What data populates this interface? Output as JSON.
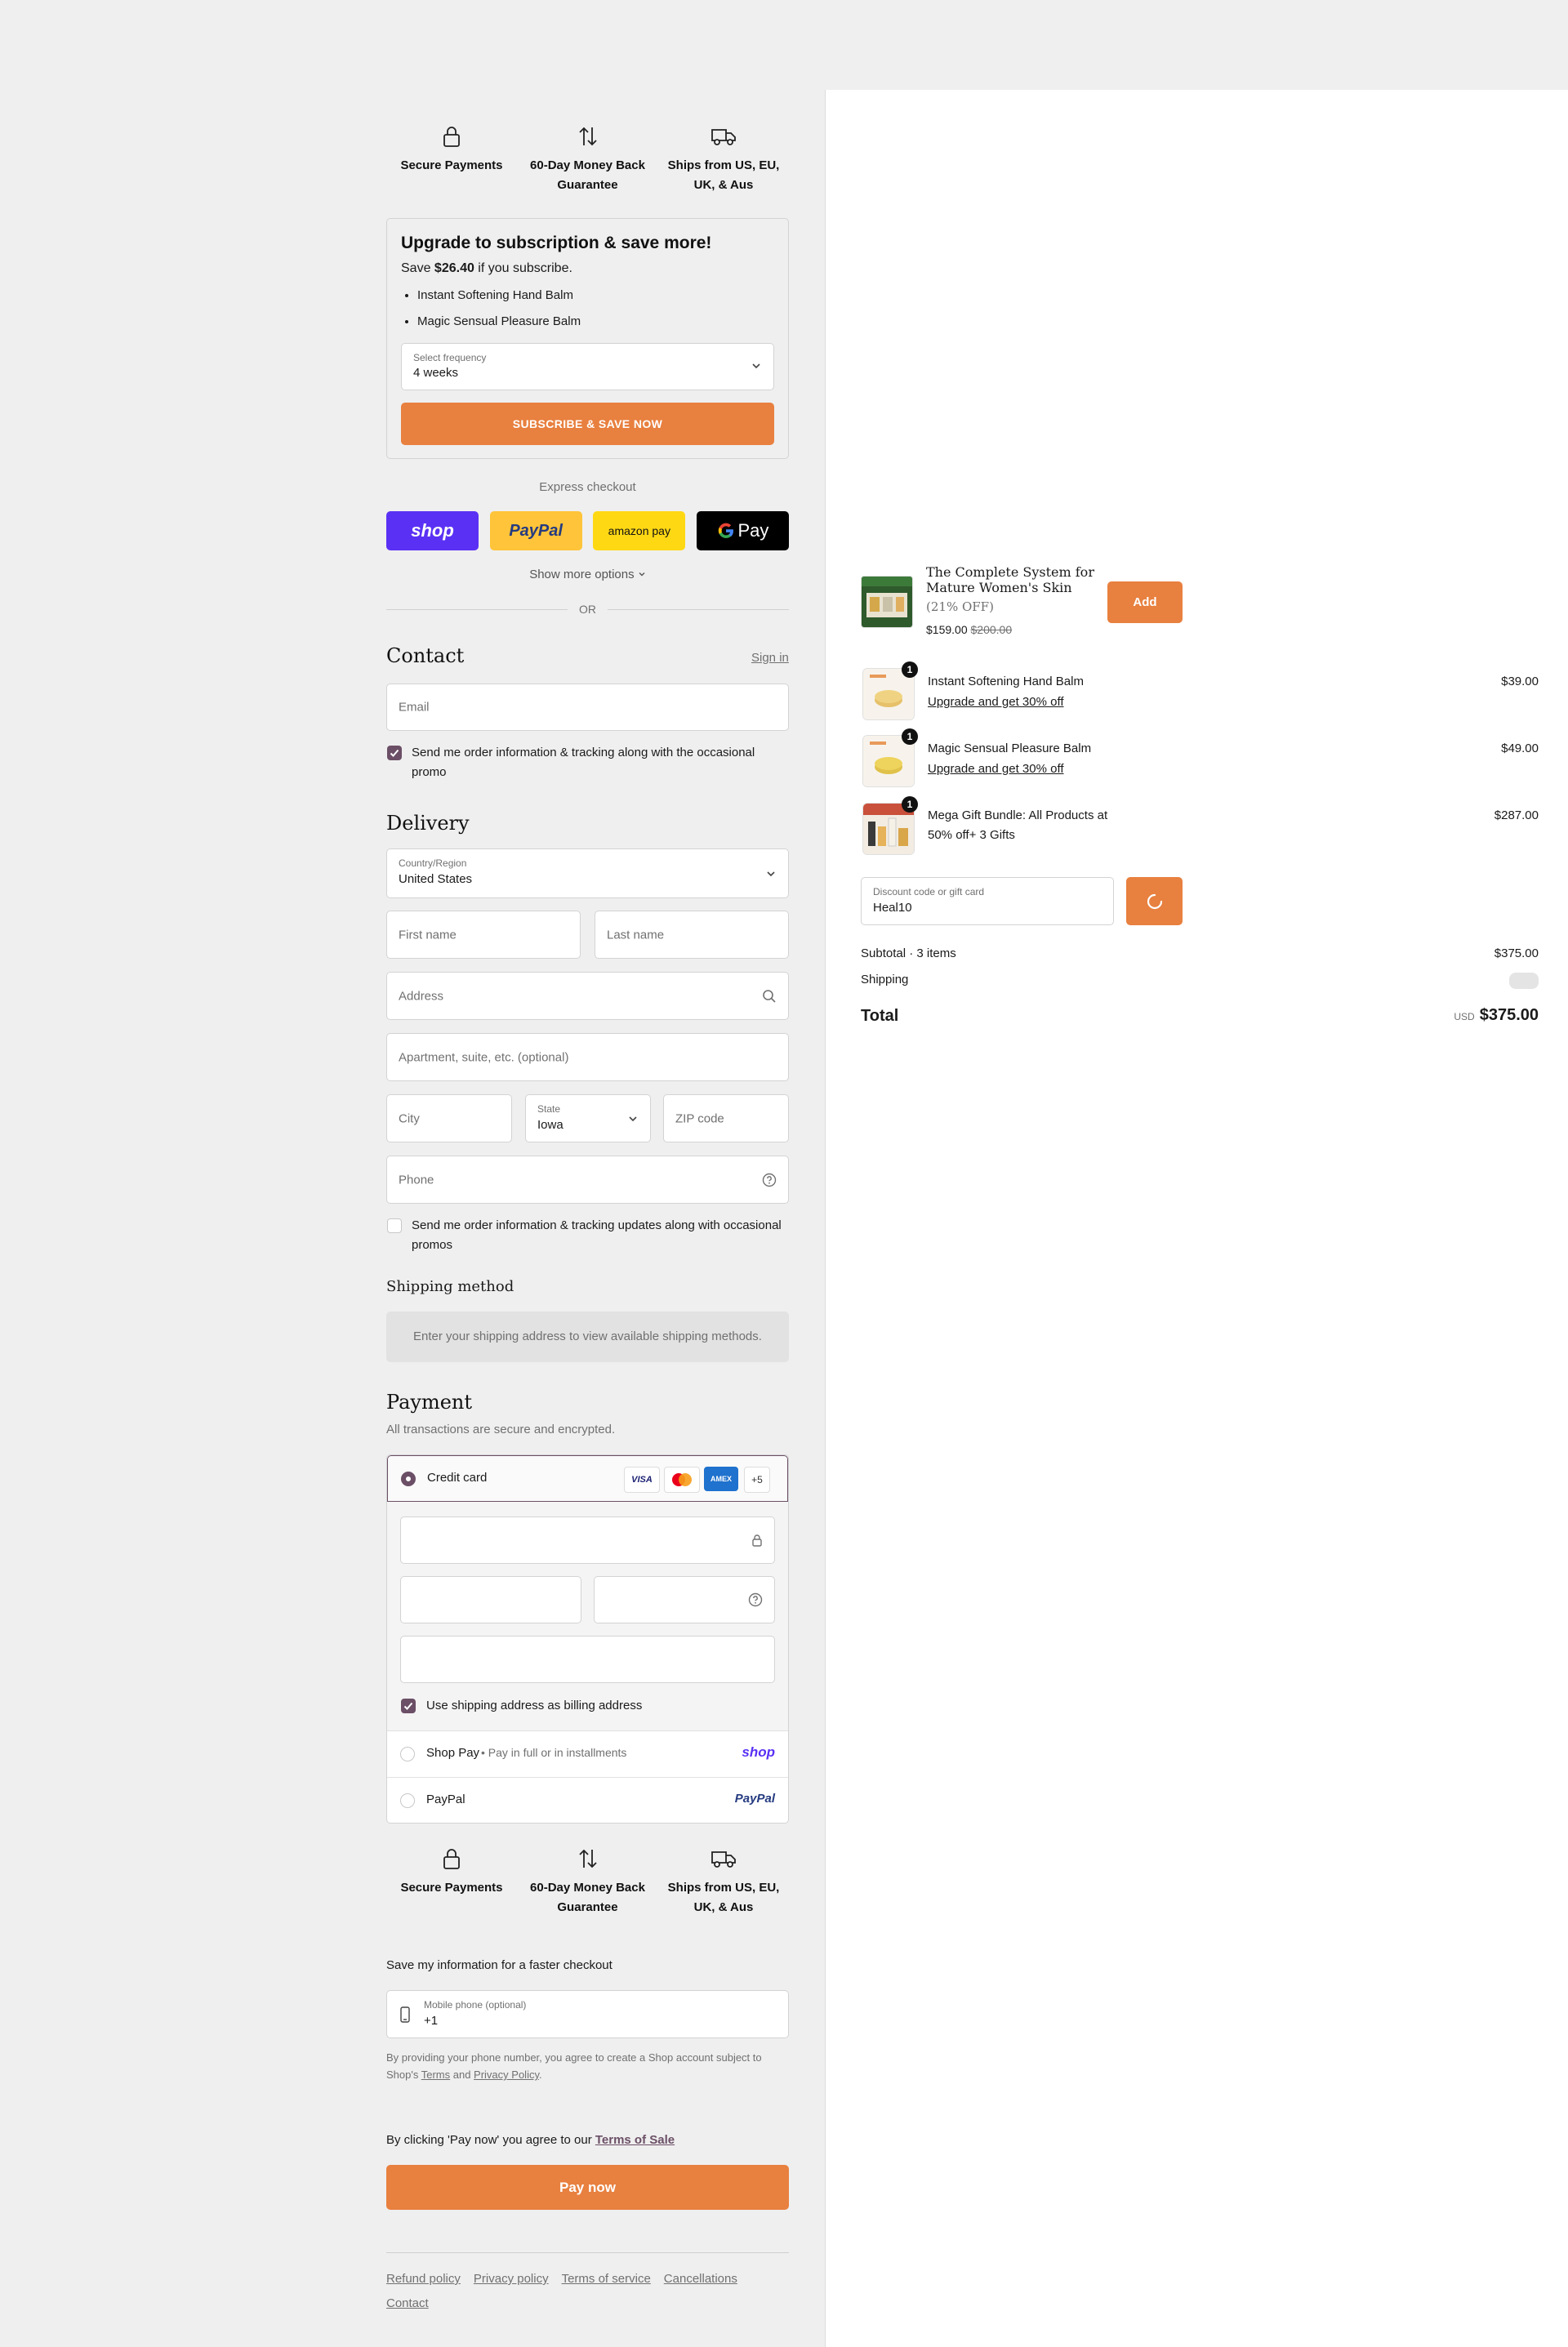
{
  "trust": [
    {
      "icon": "lock-icon",
      "label": "Secure Payments"
    },
    {
      "icon": "arrows-updown-icon",
      "label": "60-Day Money Back Guarantee"
    },
    {
      "icon": "truck-icon",
      "label": "Ships from US, EU, UK, & Aus"
    }
  ],
  "upsell": {
    "title": "Upgrade to subscription & save more!",
    "save_prefix": "Save ",
    "save_amount": "$26.40",
    "save_suffix": " if you subscribe.",
    "items": [
      "Instant Softening Hand Balm",
      "Magic Sensual Pleasure Balm"
    ],
    "frequency_label": "Select frequency",
    "frequency_value": "4 weeks",
    "button": "SUBSCRIBE & SAVE NOW"
  },
  "express": {
    "title": "Express checkout",
    "buttons": [
      {
        "name": "shop-pay",
        "label": "shop",
        "bg": "#5a31f4",
        "color": "#ffffff"
      },
      {
        "name": "paypal",
        "label": "PayPal",
        "bg": "#ffc439",
        "color": "#253b80"
      },
      {
        "name": "amazon-pay",
        "label": "amazon pay",
        "bg": "#ffd814",
        "color": "#111111"
      },
      {
        "name": "google-pay",
        "label": "Pay",
        "bg": "#000000",
        "color": "#ffffff"
      }
    ],
    "more": "Show more options",
    "or": "OR"
  },
  "contact": {
    "title": "Contact",
    "signin": "Sign in",
    "email_placeholder": "Email",
    "promo_checkbox": "Send me order information & tracking along with the occasional promo"
  },
  "delivery": {
    "title": "Delivery",
    "country_label": "Country/Region",
    "country_value": "United States",
    "first_name": "First name",
    "last_name": "Last name",
    "address": "Address",
    "apartment": "Apartment, suite, etc. (optional)",
    "city": "City",
    "state_label": "State",
    "state_value": "Iowa",
    "zip": "ZIP code",
    "phone": "Phone",
    "sms_checkbox": "Send me order information & tracking updates along with occasional promos"
  },
  "shipping": {
    "title": "Shipping method",
    "note": "Enter your shipping address to view available shipping methods."
  },
  "payment": {
    "title": "Payment",
    "subtitle": "All transactions are secure and encrypted.",
    "credit_card": "Credit card",
    "card_more": "+5",
    "billing_checkbox": "Use shipping address as billing address",
    "shop_pay": "Shop Pay",
    "shop_pay_note": "Pay in full or in installments",
    "shop_logo": "shop",
    "paypal": "PayPal",
    "paypal_logo": "PayPal"
  },
  "save_info": {
    "title": "Save my information for a faster checkout",
    "phone_label": "Mobile phone (optional)",
    "phone_value": "+1",
    "disclaimer_1": "By providing your phone number, you agree to create a Shop account subject to Shop's ",
    "terms": "Terms",
    "and": " and ",
    "privacy": "Privacy Policy",
    "end": "."
  },
  "pay": {
    "agree_prefix": "By clicking 'Pay now' you agree to our ",
    "agree_link": "Terms of Sale",
    "button": "Pay now"
  },
  "footer": [
    "Refund policy",
    "Privacy policy",
    "Terms of service",
    "Cancellations",
    "Contact"
  ],
  "upsell_product": {
    "name": "The Complete System for Mature Women's Skin",
    "discount": "(21% OFF)",
    "price": "$159.00",
    "compare": "$200.00",
    "add": "Add"
  },
  "cart": [
    {
      "qty": "1",
      "name": "Instant Softening Hand Balm",
      "link": "Upgrade and get 30% off",
      "price": "$39.00"
    },
    {
      "qty": "1",
      "name": "Magic Sensual Pleasure Balm",
      "link": "Upgrade and get 30% off",
      "price": "$49.00"
    },
    {
      "qty": "1",
      "name": "Mega Gift Bundle: All Products at 50% off+ 3 Gifts",
      "link": "",
      "price": "$287.00"
    }
  ],
  "discount": {
    "label": "Discount code or gift card",
    "value": "Heal10"
  },
  "summary": {
    "subtotal_label": "Subtotal · 3 items",
    "subtotal": "$375.00",
    "shipping_label": "Shipping",
    "total_label": "Total",
    "currency": "USD",
    "total": "$375.00"
  },
  "colors": {
    "accent": "#e8803f",
    "check": "#6b4f66"
  }
}
